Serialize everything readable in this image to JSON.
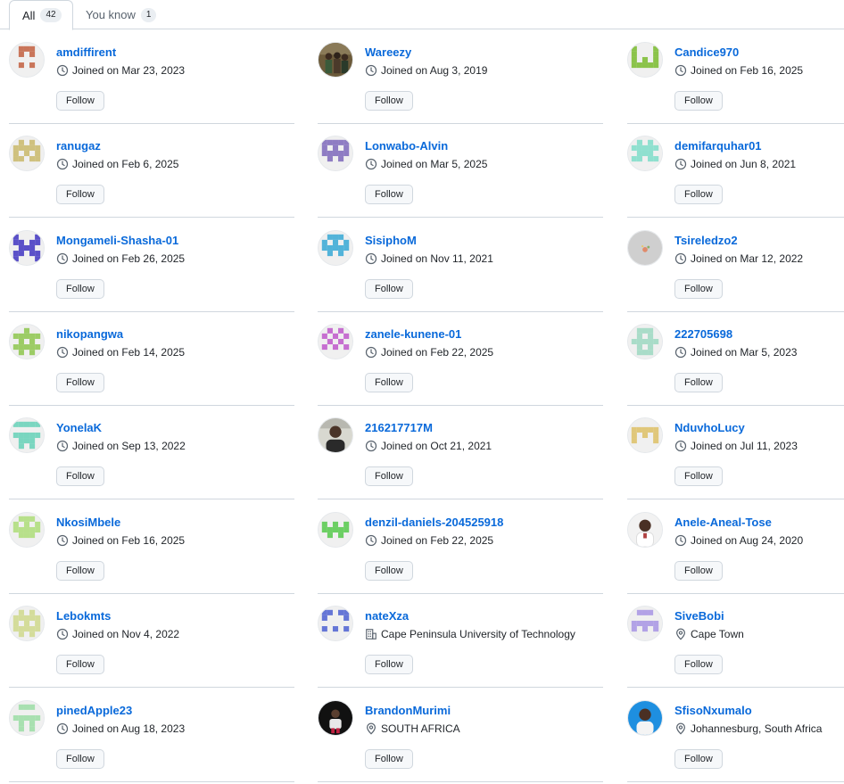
{
  "tabs": [
    {
      "label": "All",
      "count": "42"
    },
    {
      "label": "You know",
      "count": "1"
    }
  ],
  "follow_label": "Follow",
  "users": [
    {
      "name": "amdiffirent",
      "meta": "Joined on Mar 23, 2023",
      "meta_icon": "clock-icon",
      "avatar": "identicon-brown"
    },
    {
      "name": "Wareezy",
      "meta": "Joined on Aug 3, 2019",
      "meta_icon": "clock-icon",
      "avatar": "photo-group"
    },
    {
      "name": "Candice970",
      "meta": "Joined on Feb 16, 2025",
      "meta_icon": "clock-icon",
      "avatar": "identicon-green"
    },
    {
      "name": "ranugaz",
      "meta": "Joined on Feb 6, 2025",
      "meta_icon": "clock-icon",
      "avatar": "identicon-khaki"
    },
    {
      "name": "Lonwabo-Alvin",
      "meta": "Joined on Mar 5, 2025",
      "meta_icon": "clock-icon",
      "avatar": "identicon-purple"
    },
    {
      "name": "demifarquhar01",
      "meta": "Joined on Jun 8, 2021",
      "meta_icon": "clock-icon",
      "avatar": "identicon-mint"
    },
    {
      "name": "Mongameli-Shasha-01",
      "meta": "Joined on Feb 26, 2025",
      "meta_icon": "clock-icon",
      "avatar": "identicon-indigo"
    },
    {
      "name": "SisiphoM",
      "meta": "Joined on Nov 11, 2021",
      "meta_icon": "clock-icon",
      "avatar": "identicon-skyblue"
    },
    {
      "name": "Tsireledzo2",
      "meta": "Joined on Mar 12, 2022",
      "meta_icon": "clock-icon",
      "avatar": "photo-gray"
    },
    {
      "name": "nikopangwa",
      "meta": "Joined on Feb 14, 2025",
      "meta_icon": "clock-icon",
      "avatar": "identicon-lime"
    },
    {
      "name": "zanele-kunene-01",
      "meta": "Joined on Feb 22, 2025",
      "meta_icon": "clock-icon",
      "avatar": "identicon-magenta"
    },
    {
      "name": "222705698",
      "meta": "Joined on Mar 5, 2023",
      "meta_icon": "clock-icon",
      "avatar": "identicon-seafoam"
    },
    {
      "name": "YonelaK",
      "meta": "Joined on Sep 13, 2022",
      "meta_icon": "clock-icon",
      "avatar": "identicon-teal"
    },
    {
      "name": "216217717M",
      "meta": "Joined on Oct 21, 2021",
      "meta_icon": "clock-icon",
      "avatar": "photo-person"
    },
    {
      "name": "NduvhoLucy",
      "meta": "Joined on Jul 11, 2023",
      "meta_icon": "clock-icon",
      "avatar": "identicon-gold"
    },
    {
      "name": "NkosiMbele",
      "meta": "Joined on Feb 16, 2025",
      "meta_icon": "clock-icon",
      "avatar": "identicon-lightgreen"
    },
    {
      "name": "denzil-daniels-204525918",
      "meta": "Joined on Feb 22, 2025",
      "meta_icon": "clock-icon",
      "avatar": "identicon-brightgreen"
    },
    {
      "name": "Anele-Aneal-Tose",
      "meta": "Joined on Aug 24, 2020",
      "meta_icon": "clock-icon",
      "avatar": "photo-person-white"
    },
    {
      "name": "Lebokmts",
      "meta": "Joined on Nov 4, 2022",
      "meta_icon": "clock-icon",
      "avatar": "identicon-olive"
    },
    {
      "name": "nateXza",
      "meta": "Cape Peninsula University of Technology",
      "meta_icon": "organization-icon",
      "avatar": "identicon-blue"
    },
    {
      "name": "SiveBobi",
      "meta": "Cape Town",
      "meta_icon": "location-icon",
      "avatar": "identicon-lavender"
    },
    {
      "name": "pinedApple23",
      "meta": "Joined on Aug 18, 2023",
      "meta_icon": "clock-icon",
      "avatar": "identicon-palegreen"
    },
    {
      "name": "BrandonMurimi",
      "meta": "SOUTH AFRICA",
      "meta_icon": "location-icon",
      "avatar": "photo-dark"
    },
    {
      "name": "SfisoNxumalo",
      "meta": "Johannesburg, South Africa",
      "meta_icon": "location-icon",
      "avatar": "photo-blue"
    }
  ],
  "colors": {
    "link": "#0969da",
    "border": "#d0d7de",
    "button_bg": "#f6f8fa"
  }
}
